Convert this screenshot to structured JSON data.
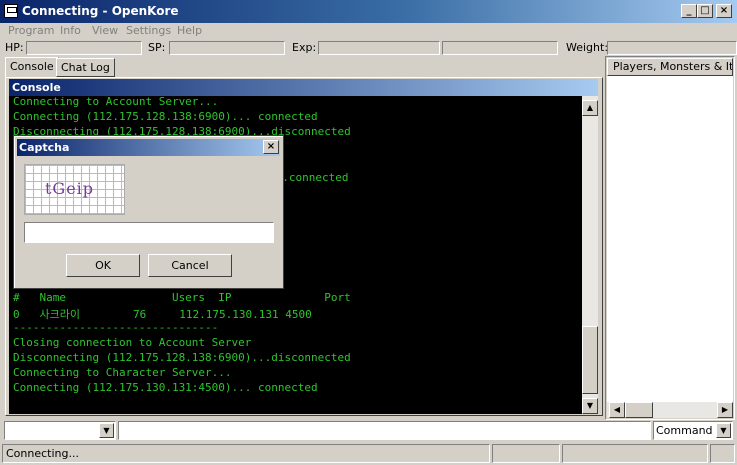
{
  "window": {
    "title": "Connecting - OpenKore",
    "controls": {
      "minimize": "_",
      "maximize": "□",
      "close": "×"
    }
  },
  "menu": [
    "Program",
    "Info",
    "View",
    "Settings",
    "Help"
  ],
  "stats": {
    "hp_label": "HP:",
    "sp_label": "SP:",
    "exp_label": "Exp:",
    "weight_label": "Weight:"
  },
  "tabs": [
    {
      "label": "Console"
    },
    {
      "label": "Chat Log"
    }
  ],
  "console": {
    "header": "Console",
    "lines": [
      "Connecting to Account Server...",
      "Connecting (112.175.128.138:6900)... connected",
      "Disconnecting (112.175.128.138:6900)...disconnected",
      "",
      "",
      "...connected",
      "",
      "",
      "",
      "",
      "",
      "",
      "",
      "#   Name                Users  IP              Port",
      "0   사크라이        76     112.175.130.131 4500",
      "-------------------------------",
      "Closing connection to Account Server",
      "Disconnecting (112.175.128.138:6900)...disconnected",
      "Connecting to Character Server...",
      "Connecting (112.175.130.131:4500)... connected"
    ]
  },
  "right_panel": {
    "header": "Players, Monsters & Items"
  },
  "command": {
    "selected": "Command",
    "input_value": ""
  },
  "status": {
    "text": "Connecting..."
  },
  "dialog": {
    "title": "Captcha",
    "captcha_text": "tGeip",
    "input_value": "",
    "ok_label": "OK",
    "cancel_label": "Cancel",
    "close_label": "×"
  },
  "colors": {
    "console_text": "#2ec42e",
    "console_bg": "#000000",
    "title_gradient_start": "#0a246a"
  }
}
